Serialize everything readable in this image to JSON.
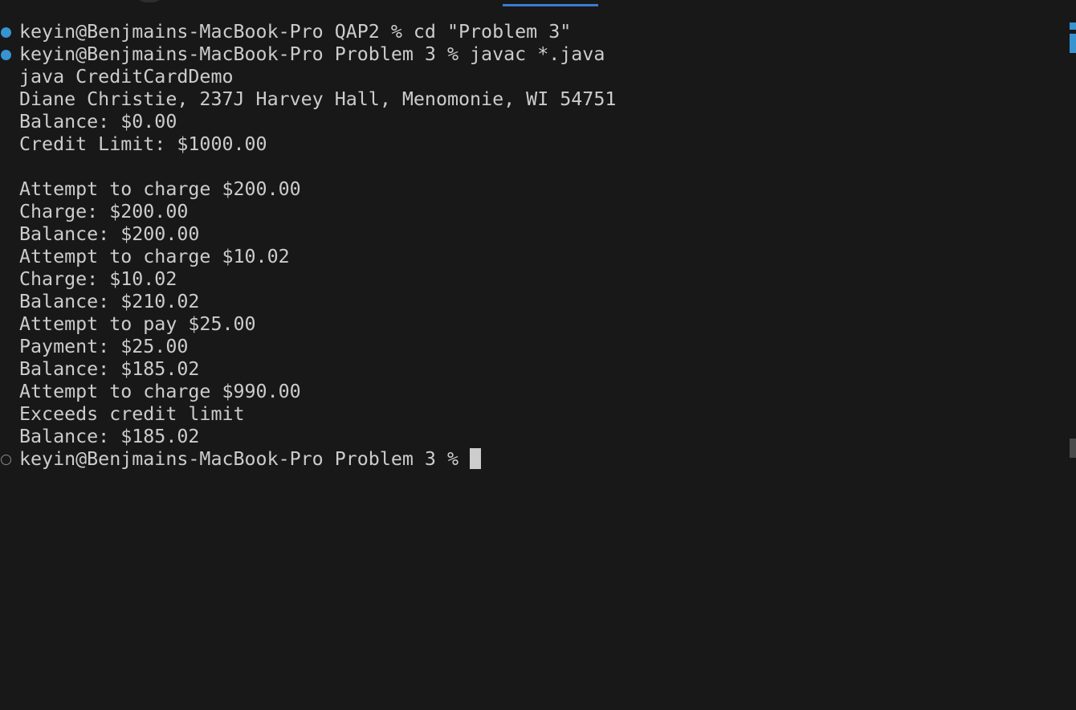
{
  "terminal": {
    "lines": [
      {
        "text": "keyin@Benjmains-MacBook-Pro QAP2 % cd \"Problem 3\"",
        "decoration": "success"
      },
      {
        "text": "keyin@Benjmains-MacBook-Pro Problem 3 % javac *.java",
        "decoration": "success"
      },
      {
        "text": "java CreditCardDemo"
      },
      {
        "text": "Diane Christie, 237J Harvey Hall, Menomonie, WI 54751"
      },
      {
        "text": "Balance: $0.00"
      },
      {
        "text": "Credit Limit: $1000.00"
      },
      {
        "text": ""
      },
      {
        "text": "Attempt to charge $200.00"
      },
      {
        "text": "Charge: $200.00"
      },
      {
        "text": "Balance: $200.00"
      },
      {
        "text": "Attempt to charge $10.02"
      },
      {
        "text": "Charge: $10.02"
      },
      {
        "text": "Balance: $210.02"
      },
      {
        "text": "Attempt to pay $25.00"
      },
      {
        "text": "Payment: $25.00"
      },
      {
        "text": "Balance: $185.02"
      },
      {
        "text": "Attempt to charge $990.00"
      },
      {
        "text": "Exceeds credit limit"
      },
      {
        "text": "Balance: $185.02"
      }
    ],
    "prompt": {
      "text": "keyin@Benjmains-MacBook-Pro Problem 3 % ",
      "decoration": "pending"
    }
  },
  "colors": {
    "background": "#181818",
    "foreground": "#cccccc",
    "success_decoration": "#3794d1",
    "active_tab_indicator": "#3b7bd1"
  }
}
